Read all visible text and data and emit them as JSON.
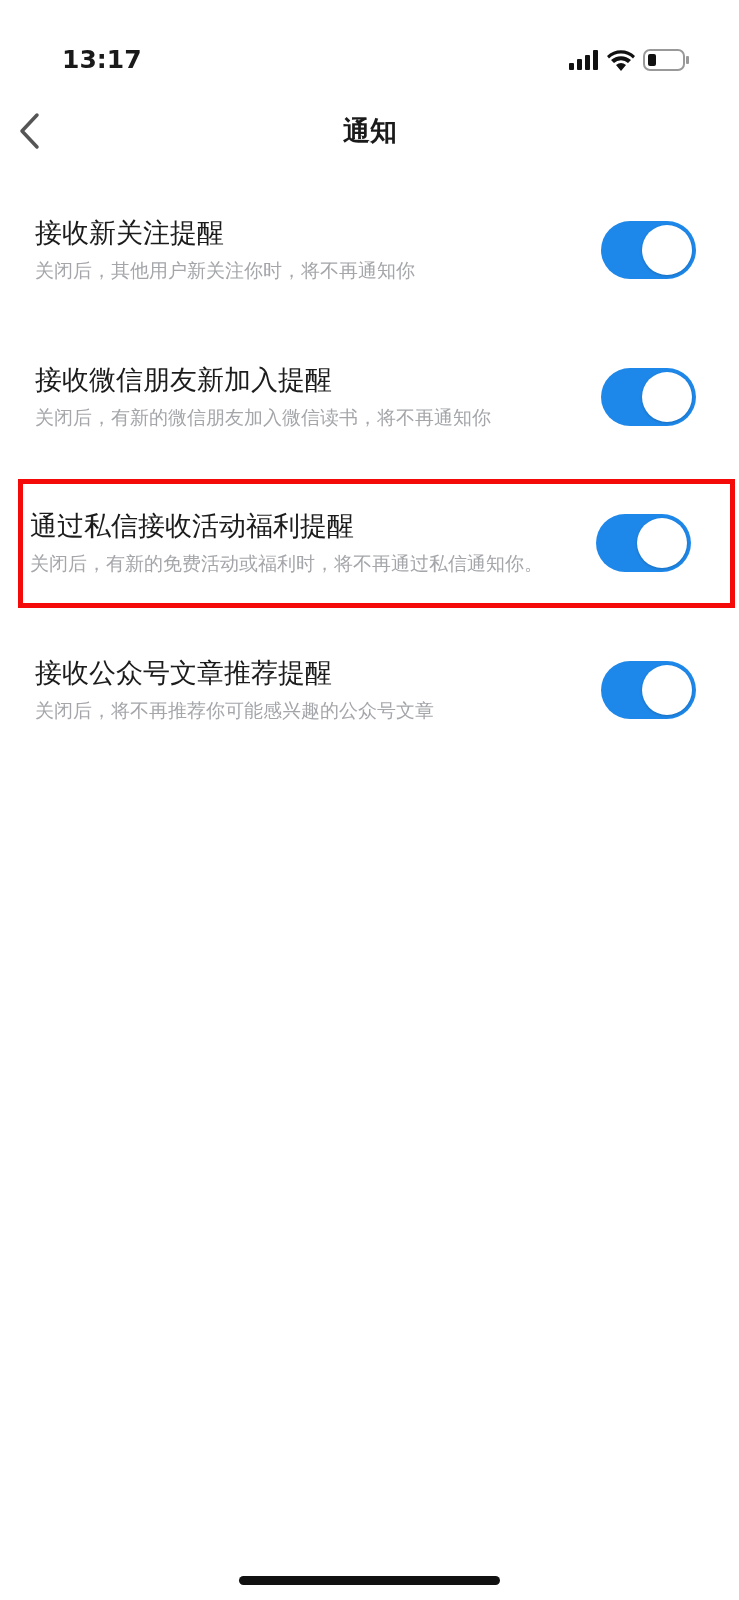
{
  "status_bar": {
    "time": "13:17"
  },
  "nav": {
    "title": "通知"
  },
  "settings": [
    {
      "title": "接收新关注提醒",
      "description": "关闭后，其他用户新关注你时，将不再通知你",
      "on": true,
      "highlighted": false
    },
    {
      "title": "接收微信朋友新加入提醒",
      "description": "关闭后，有新的微信朋友加入微信读书，将不再通知你",
      "on": true,
      "highlighted": false
    },
    {
      "title": "通过私信接收活动福利提醒",
      "description": "关闭后，有新的免费活动或福利时，将不再通过私信通知你。",
      "on": true,
      "highlighted": true
    },
    {
      "title": "接收公众号文章推荐提醒",
      "description": "关闭后，将不再推荐你可能感兴趣的公众号文章",
      "on": true,
      "highlighted": false
    }
  ]
}
